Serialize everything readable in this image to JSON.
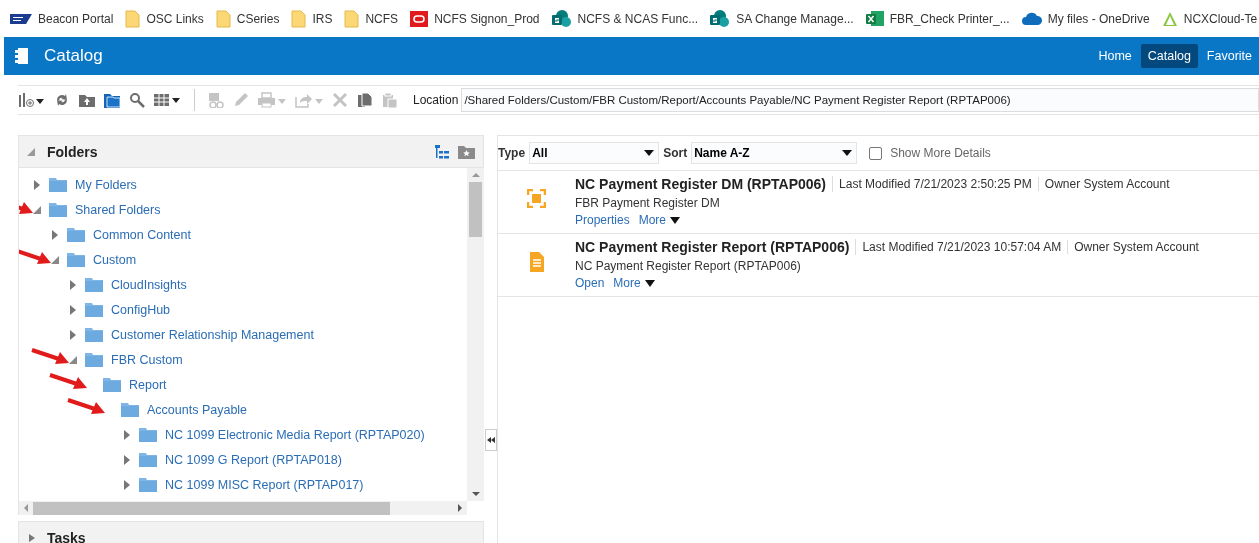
{
  "bookmarks": [
    {
      "kind": "sap",
      "label": "Beacon Portal"
    },
    {
      "kind": "folder",
      "label": "OSC Links"
    },
    {
      "kind": "folder",
      "label": "CSeries"
    },
    {
      "kind": "folder",
      "label": "IRS"
    },
    {
      "kind": "folder",
      "label": "NCFS"
    },
    {
      "kind": "oracle",
      "label": "NCFS Signon_Prod"
    },
    {
      "kind": "sharepoint",
      "label": "NCFS & NCAS Func..."
    },
    {
      "kind": "sharepoint",
      "label": "SA Change Manage..."
    },
    {
      "kind": "excel",
      "label": "FBR_Check Printer_..."
    },
    {
      "kind": "cloud",
      "label": "My files - OneDrive"
    },
    {
      "kind": "triangle",
      "label": "NCXCloud-Te"
    }
  ],
  "header": {
    "title": "Catalog",
    "nav": [
      {
        "label": "Home",
        "selected": false
      },
      {
        "label": "Catalog",
        "selected": true
      },
      {
        "label": "Favorite",
        "selected": false
      }
    ]
  },
  "toolbar": {
    "location_label": "Location",
    "location": "/Shared Folders/Custom/FBR Custom/Report/Accounts Payable/NC Payment Register Report (RPTAP006)"
  },
  "folders_panel": {
    "title": "Folders",
    "expanded": true,
    "tree": [
      {
        "label": "My Folders",
        "expanded": false,
        "arrow": false
      },
      {
        "label": "Shared Folders",
        "expanded": true,
        "arrow": true,
        "children": [
          {
            "label": "Common Content",
            "expanded": false,
            "arrow": false
          },
          {
            "label": "Custom",
            "expanded": true,
            "arrow": true,
            "children": [
              {
                "label": "CloudInsights",
                "expanded": false,
                "arrow": false
              },
              {
                "label": "ConfigHub",
                "expanded": false,
                "arrow": false
              },
              {
                "label": "Customer Relationship Management",
                "expanded": false,
                "arrow": false
              },
              {
                "label": "FBR Custom",
                "expanded": true,
                "arrow": true,
                "children": [
                  {
                    "label": "Report",
                    "arrow": true,
                    "children": [
                      {
                        "label": "Accounts Payable",
                        "arrow": true,
                        "children": [
                          {
                            "label": "NC 1099 Electronic Media Report (RPTAP020)",
                            "expanded": false,
                            "arrow": false
                          },
                          {
                            "label": "NC 1099 G Report (RPTAP018)",
                            "expanded": false,
                            "arrow": false
                          },
                          {
                            "label": "NC 1099 MISC Report (RPTAP017)",
                            "expanded": false,
                            "arrow": false
                          }
                        ]
                      }
                    ]
                  }
                ]
              }
            ]
          }
        ]
      }
    ]
  },
  "tasks_panel": {
    "title": "Tasks",
    "expanded": false
  },
  "filters": {
    "type_label": "Type",
    "type_value": "All",
    "sort_label": "Sort",
    "sort_value": "Name A-Z",
    "show_more_details": {
      "label": "Show More Details",
      "checked": false
    }
  },
  "items": [
    {
      "kind": "data_model",
      "title": "NC Payment Register DM (RPTAP006)",
      "last_modified": "Last Modified 7/21/2023 2:50:25 PM",
      "owner": "Owner System Account",
      "description": "FBR Payment Register DM",
      "actions": [
        "Properties",
        "More"
      ]
    },
    {
      "kind": "report",
      "title": "NC Payment Register Report (RPTAP006)",
      "last_modified": "Last Modified 7/21/2023 10:57:04 AM",
      "owner": "Owner System Account",
      "description": "NC Payment Register Report (RPTAP006)",
      "actions": [
        "Open",
        "More"
      ]
    }
  ]
}
